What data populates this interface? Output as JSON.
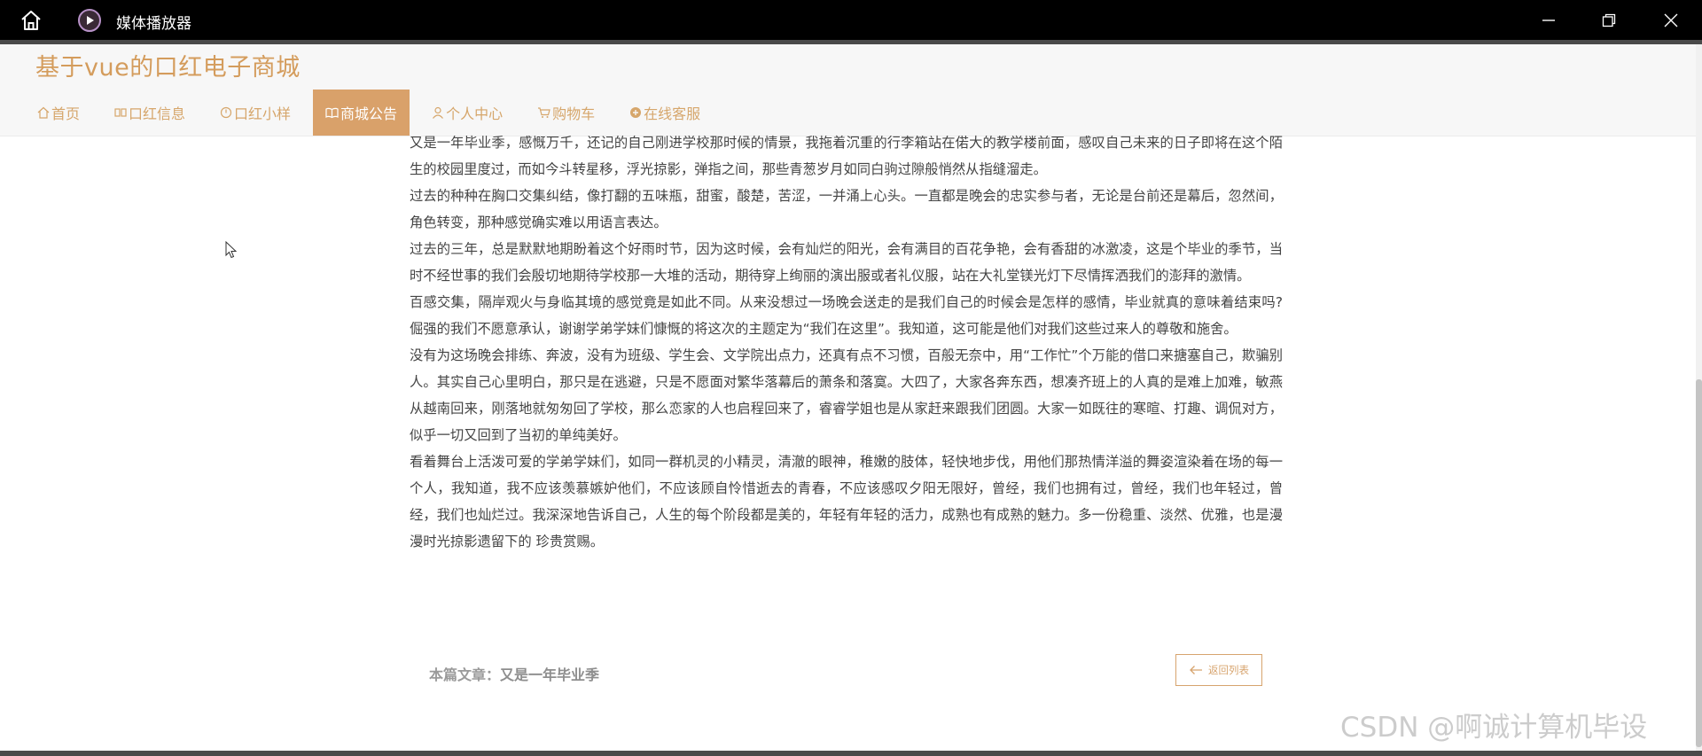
{
  "window": {
    "title": "媒体播放器",
    "icons": [
      "home-icon",
      "media-player-icon",
      "minimize-icon",
      "maximize-icon",
      "close-icon"
    ]
  },
  "header": {
    "site_title": "基于vue的口红电子商城",
    "nav": [
      {
        "label": "首页",
        "icon": "home-icon"
      },
      {
        "label": "口红信息",
        "icon": "grid-icon"
      },
      {
        "label": "口红小样",
        "icon": "clock-icon"
      },
      {
        "label": "商城公告",
        "icon": "book-icon",
        "active": true
      },
      {
        "label": "个人中心",
        "icon": "user-icon"
      },
      {
        "label": "购物车",
        "icon": "cart-icon"
      },
      {
        "label": "在线客服",
        "icon": "chat-icon"
      }
    ]
  },
  "article": {
    "paragraphs": [
      "又是一年毕业季，感慨万千，还记的自己刚进学校那时候的情景，我拖着沉重的行李箱站在偌大的教学楼前面，感叹自己未来的日子即将在这个陌生的校园里度过，而如今斗转星移，浮光掠影，弹指之间，那些青葱岁月如同白驹过隙般悄然从指缝溜走。",
      "过去的种种在胸口交集纠结，像打翻的五味瓶，甜蜜，酸楚，苦涩，一并涌上心头。一直都是晚会的忠实参与者，无论是台前还是幕后，忽然间，角色转变，那种感觉确实难以用语言表达。",
      "过去的三年，总是默默地期盼着这个好雨时节，因为这时候，会有灿烂的阳光，会有满目的百花争艳，会有香甜的冰激凌，这是个毕业的季节，当时不经世事的我们会殷切地期待学校那一大堆的活动，期待穿上绚丽的演出服或者礼仪服，站在大礼堂镁光灯下尽情挥洒我们的澎拜的激情。",
      "百感交集，隔岸观火与身临其境的感觉竟是如此不同。从来没想过一场晚会送走的是我们自己的时候会是怎样的感情，毕业就真的意味着结束吗?倔强的我们不愿意承认，谢谢学弟学妹们慷慨的将这次的主题定为“我们在这里”。我知道，这可能是他们对我们这些过来人的尊敬和施舍。",
      "没有为这场晚会排练、奔波，没有为班级、学生会、文学院出点力，还真有点不习惯，百般无奈中，用“工作忙”个万能的借口来搪塞自己，欺骗别人。其实自己心里明白，那只是在逃避，只是不愿面对繁华落幕后的萧条和落寞。大四了，大家各奔东西，想凑齐班上的人真的是难上加难，敏燕从越南回来，刚落地就匆匆回了学校，那么恋家的人也启程回来了，睿睿学姐也是从家赶来跟我们团圆。大家一如既往的寒暄、打趣、调侃对方，似乎一切又回到了当初的单纯美好。",
      "看着舞台上活泼可爱的学弟学妹们，如同一群机灵的小精灵，清澈的眼神，稚嫩的肢体，轻快地步伐，用他们那热情洋溢的舞姿渲染着在场的每一个人，我知道，我不应该羡慕嫉妒他们，不应该顾自怜惜逝去的青春，不应该感叹夕阳无限好，曾经，我们也拥有过，曾经，我们也年轻过，曾经，我们也灿烂过。我深深地告诉自己，人生的每个阶段都是美的，年轻有年轻的活力，成熟也有成熟的魅力。多一份稳重、淡然、优雅，也是漫漫时光掠影遗留下的 珍贵赏赐。"
    ],
    "current_label": "本篇文章：",
    "current_title": "又是一年毕业季",
    "back_button": "返回列表"
  },
  "watermark": "CSDN @啊诚计算机毕设",
  "colors": {
    "accent": "#d9a16a",
    "site_title": "#d49c5c",
    "titlebar": "#000000",
    "text": "#444444"
  }
}
